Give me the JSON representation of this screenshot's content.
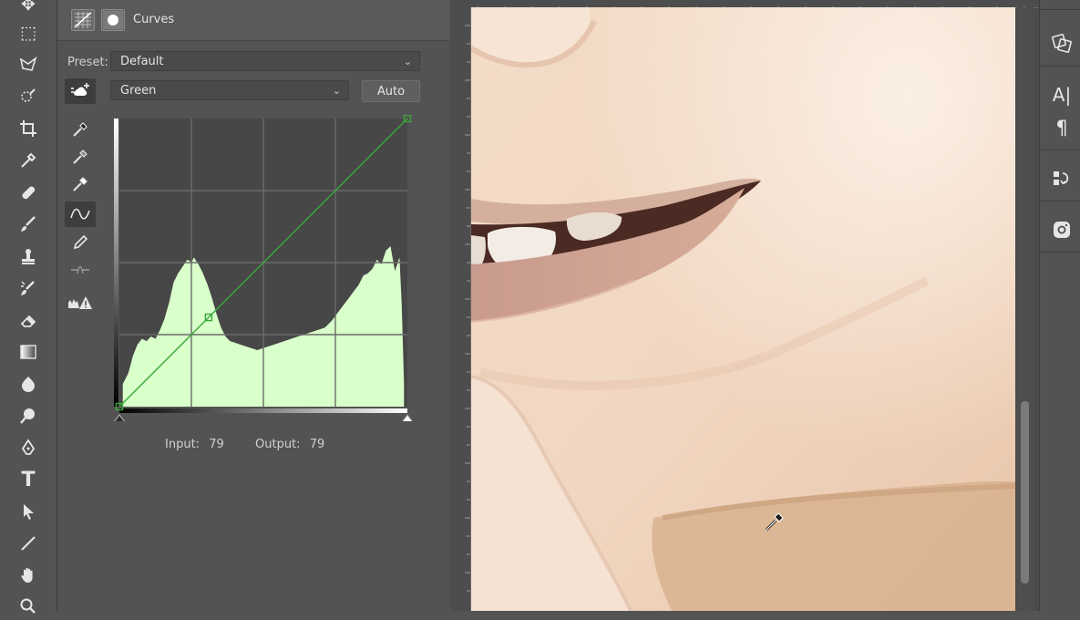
{
  "panel": {
    "title": "Curves",
    "preset_label": "Preset:",
    "preset_value": "Default",
    "channel_value": "Green",
    "auto_label": "Auto",
    "input_label": "Input:",
    "input_value": "79",
    "output_label": "Output:",
    "output_value": "79"
  },
  "tools_left": [
    "move-icon",
    "marquee-icon",
    "lasso-icon",
    "quick-select-icon",
    "crop-icon",
    "eyedropper-icon",
    "healing-brush-icon",
    "brush-icon",
    "clone-stamp-icon",
    "history-brush-icon",
    "eraser-icon",
    "gradient-icon",
    "blur-icon",
    "dodge-icon",
    "pen-icon",
    "type-icon",
    "path-select-icon",
    "line-icon",
    "hand-icon",
    "zoom-icon"
  ],
  "tools_right": [
    "properties-icon",
    "character-icon",
    "paragraph-icon",
    "history-icon",
    "instagram-icon"
  ],
  "colors": {
    "curve": "#39a83a",
    "histogram": "#d9ffca",
    "ui_bg": "#535353"
  },
  "chart_data": {
    "type": "area",
    "title": "",
    "xlim": [
      0,
      255
    ],
    "ylim": [
      0,
      255
    ],
    "curve_points": [
      [
        0,
        0
      ],
      [
        79,
        79
      ],
      [
        255,
        255
      ]
    ],
    "histogram": [
      [
        3,
        20
      ],
      [
        8,
        30
      ],
      [
        12,
        45
      ],
      [
        16,
        55
      ],
      [
        20,
        60
      ],
      [
        24,
        58
      ],
      [
        28,
        62
      ],
      [
        32,
        60
      ],
      [
        36,
        68
      ],
      [
        40,
        78
      ],
      [
        44,
        92
      ],
      [
        48,
        110
      ],
      [
        52,
        118
      ],
      [
        56,
        124
      ],
      [
        60,
        130
      ],
      [
        64,
        128
      ],
      [
        66,
        132
      ],
      [
        70,
        126
      ],
      [
        74,
        118
      ],
      [
        78,
        108
      ],
      [
        82,
        96
      ],
      [
        86,
        82
      ],
      [
        90,
        70
      ],
      [
        94,
        62
      ],
      [
        98,
        58
      ],
      [
        104,
        56
      ],
      [
        110,
        54
      ],
      [
        116,
        52
      ],
      [
        122,
        50
      ],
      [
        128,
        52
      ],
      [
        134,
        54
      ],
      [
        140,
        56
      ],
      [
        146,
        58
      ],
      [
        152,
        60
      ],
      [
        158,
        62
      ],
      [
        164,
        64
      ],
      [
        170,
        66
      ],
      [
        176,
        68
      ],
      [
        182,
        70
      ],
      [
        188,
        76
      ],
      [
        194,
        84
      ],
      [
        200,
        92
      ],
      [
        206,
        100
      ],
      [
        212,
        108
      ],
      [
        216,
        116
      ],
      [
        220,
        118
      ],
      [
        224,
        122
      ],
      [
        228,
        130
      ],
      [
        232,
        126
      ],
      [
        236,
        138
      ],
      [
        240,
        142
      ],
      [
        244,
        120
      ],
      [
        248,
        132
      ],
      [
        250,
        90
      ],
      [
        252,
        20
      ]
    ]
  }
}
